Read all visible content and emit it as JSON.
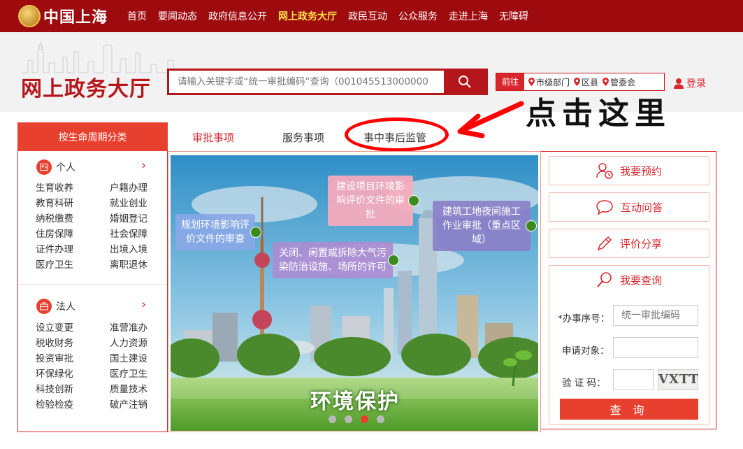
{
  "topbar": {
    "logo_text": "中国上海",
    "nav": [
      "首页",
      "要闻动态",
      "政府信息公开",
      "网上政务大厅",
      "政民互动",
      "公众服务",
      "走进上海",
      "无障碍"
    ],
    "active_nav_index": 3
  },
  "header": {
    "title": "网上政务大厅",
    "search": {
      "placeholder": "请输入关键字或“统一审批编码”查询（001045513000000"
    },
    "region": {
      "go_label": "前往",
      "items": [
        "市级部门",
        "区县",
        "管委会"
      ]
    },
    "login_label": "登录"
  },
  "annotation": {
    "text": "点击这里"
  },
  "tabs": {
    "lifecycle_label": "按生命周期分类",
    "items": [
      "审批事项",
      "服务事项",
      "事中事后监管"
    ],
    "active_index": 0
  },
  "categories": {
    "personal": {
      "title": "个人",
      "links": [
        "生育收养",
        "户籍办理",
        "教育科研",
        "就业创业",
        "纳税缴费",
        "婚姻登记",
        "住房保障",
        "社会保障",
        "证件办理",
        "出境入境",
        "医疗卫生",
        "离职退休"
      ]
    },
    "legal": {
      "title": "法人",
      "links": [
        "设立变更",
        "准营准办",
        "税收财务",
        "人力资源",
        "投资审批",
        "国土建设",
        "环保绿化",
        "医疗卫生",
        "科技创新",
        "质量技术",
        "检验检疫",
        "破产注销"
      ]
    }
  },
  "banner": {
    "bubbles": [
      "规划环境影响评价文件的审查",
      "建设项目环境影响评价文件的审批",
      "关闭、闲置或拆除大气污染防治设施、场所的许可",
      "建筑工地夜间施工作业审批（重点区域）"
    ],
    "caption": "环境保护",
    "slide_count": 4,
    "active_slide": 2
  },
  "services": {
    "appointment_label": "我要预约",
    "qa_label": "互动问答",
    "review_label": "评价分享",
    "query": {
      "title": "我要查询",
      "serial_label": "*办事序号：",
      "serial_placeholder": "统一审批编码",
      "applicant_label": "申请对象：",
      "captcha_label": "验 证 码：",
      "captcha_text": "VXTT",
      "submit_label": "查 询"
    }
  },
  "colors": {
    "brand_red": "#9e0b0f",
    "accent_red": "#e8402f",
    "highlight_yellow": "#ffe34d"
  }
}
